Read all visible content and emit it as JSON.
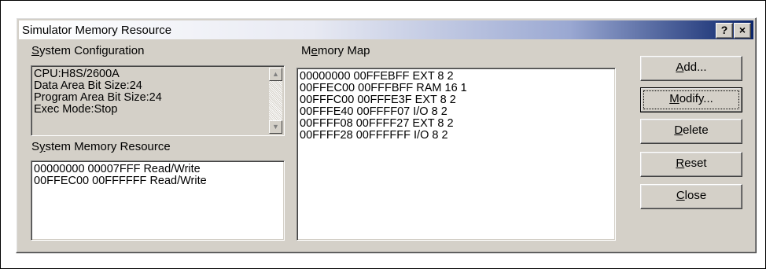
{
  "dialog": {
    "title": "Simulator Memory Resource",
    "help_label": "?",
    "close_label": "×"
  },
  "system_configuration": {
    "label_prefix": "",
    "label_accel": "S",
    "label_rest": "ystem Configuration",
    "lines": [
      "CPU:H8S/2600A",
      "Data Area Bit Size:24",
      "Program Area Bit Size:24",
      "Exec Mode:Stop"
    ]
  },
  "system_memory_resource": {
    "label_prefix": "S",
    "label_accel": "y",
    "label_rest": "stem Memory Resource",
    "lines": [
      "00000000 00007FFF Read/Write",
      "00FFEC00 00FFFFFF Read/Write"
    ]
  },
  "memory_map": {
    "label_prefix": "M",
    "label_accel": "e",
    "label_rest": "mory Map",
    "lines": [
      "00000000 00FFEBFF EXT 8 2",
      "00FFEC00 00FFFBFF RAM 16 1",
      "00FFFC00 00FFFE3F EXT 8 2",
      "00FFFE40 00FFFF07 I/O 8 2",
      "00FFFF08 00FFFF27 EXT 8 2",
      "00FFFF28 00FFFFFF I/O 8 2"
    ]
  },
  "buttons": {
    "add": {
      "accel": "A",
      "rest": "dd..."
    },
    "modify": {
      "accel": "M",
      "rest": "odify..."
    },
    "delete": {
      "accel": "D",
      "rest": "elete"
    },
    "reset": {
      "accel": "R",
      "rest": "eset"
    },
    "close": {
      "accel": "C",
      "rest": "lose"
    }
  }
}
